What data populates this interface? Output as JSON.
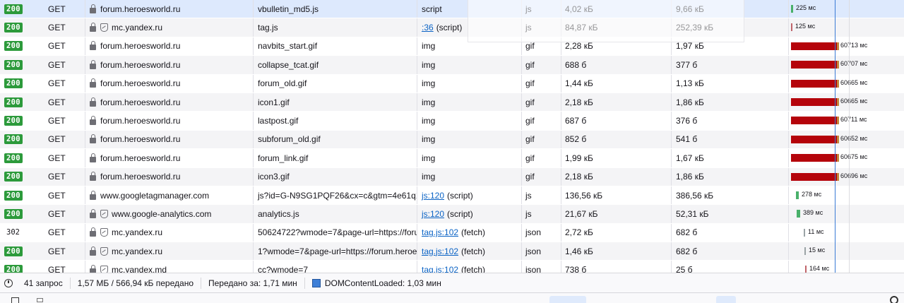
{
  "colors": {
    "status_ok": "#2c9a3b",
    "waterfall_block": "#b5040b",
    "waterfall_green": "#49b06a",
    "selected_row": "#dde9fd",
    "link": "#0b63c5"
  },
  "requests": [
    {
      "status": "200",
      "status_badge": true,
      "method": "GET",
      "tracker": false,
      "domain": "forum.heroesworld.ru",
      "file": "vbulletin_md5.js",
      "initiator_link": "",
      "initiator": "script",
      "type": "js",
      "transferred": "4,02 кБ",
      "size": "9,66 кБ",
      "timing": "225 мс",
      "blocked_ms": 0,
      "wait_ms": 225,
      "selected": true
    },
    {
      "status": "200",
      "status_badge": true,
      "method": "GET",
      "tracker": true,
      "domain": "mc.yandex.ru",
      "file": "tag.js",
      "initiator_link": ":36",
      "initiator": "(script)",
      "type": "js",
      "transferred": "84,87 кБ",
      "size": "252,39 кБ",
      "timing": "125 мс",
      "blocked_ms": 0,
      "wait_ms": 125,
      "selected": false
    },
    {
      "status": "200",
      "status_badge": true,
      "method": "GET",
      "tracker": false,
      "domain": "forum.heroesworld.ru",
      "file": "navbits_start.gif",
      "initiator_link": "",
      "initiator": "img",
      "type": "gif",
      "transferred": "2,28 кБ",
      "size": "1,97 кБ",
      "timing": "60713 мс",
      "blocked_ms": 60713,
      "wait_ms": 0,
      "selected": false
    },
    {
      "status": "200",
      "status_badge": true,
      "method": "GET",
      "tracker": false,
      "domain": "forum.heroesworld.ru",
      "file": "collapse_tcat.gif",
      "initiator_link": "",
      "initiator": "img",
      "type": "gif",
      "transferred": "688 б",
      "size": "377 б",
      "timing": "60707 мс",
      "blocked_ms": 60707,
      "wait_ms": 0,
      "selected": false
    },
    {
      "status": "200",
      "status_badge": true,
      "method": "GET",
      "tracker": false,
      "domain": "forum.heroesworld.ru",
      "file": "forum_old.gif",
      "initiator_link": "",
      "initiator": "img",
      "type": "gif",
      "transferred": "1,44 кБ",
      "size": "1,13 кБ",
      "timing": "60665 мс",
      "blocked_ms": 60665,
      "wait_ms": 0,
      "selected": false
    },
    {
      "status": "200",
      "status_badge": true,
      "method": "GET",
      "tracker": false,
      "domain": "forum.heroesworld.ru",
      "file": "icon1.gif",
      "initiator_link": "",
      "initiator": "img",
      "type": "gif",
      "transferred": "2,18 кБ",
      "size": "1,86 кБ",
      "timing": "60665 мс",
      "blocked_ms": 60665,
      "wait_ms": 0,
      "selected": false
    },
    {
      "status": "200",
      "status_badge": true,
      "method": "GET",
      "tracker": false,
      "domain": "forum.heroesworld.ru",
      "file": "lastpost.gif",
      "initiator_link": "",
      "initiator": "img",
      "type": "gif",
      "transferred": "687 б",
      "size": "376 б",
      "timing": "60711 мс",
      "blocked_ms": 60711,
      "wait_ms": 0,
      "selected": false
    },
    {
      "status": "200",
      "status_badge": true,
      "method": "GET",
      "tracker": false,
      "domain": "forum.heroesworld.ru",
      "file": "subforum_old.gif",
      "initiator_link": "",
      "initiator": "img",
      "type": "gif",
      "transferred": "852 б",
      "size": "541 б",
      "timing": "60652 мс",
      "blocked_ms": 60652,
      "wait_ms": 0,
      "selected": false
    },
    {
      "status": "200",
      "status_badge": true,
      "method": "GET",
      "tracker": false,
      "domain": "forum.heroesworld.ru",
      "file": "forum_link.gif",
      "initiator_link": "",
      "initiator": "img",
      "type": "gif",
      "transferred": "1,99 кБ",
      "size": "1,67 кБ",
      "timing": "60675 мс",
      "blocked_ms": 60675,
      "wait_ms": 0,
      "selected": false
    },
    {
      "status": "200",
      "status_badge": true,
      "method": "GET",
      "tracker": false,
      "domain": "forum.heroesworld.ru",
      "file": "icon3.gif",
      "initiator_link": "",
      "initiator": "img",
      "type": "gif",
      "transferred": "2,18 кБ",
      "size": "1,86 кБ",
      "timing": "60696 мс",
      "blocked_ms": 60696,
      "wait_ms": 0,
      "selected": false
    },
    {
      "status": "200",
      "status_badge": true,
      "method": "GET",
      "tracker": false,
      "domain": "www.googletagmanager.com",
      "file": "js?id=G-N9SG1PQF26&cx=c&gtm=4e61q1",
      "initiator_link": "js:120",
      "initiator": "(script)",
      "type": "js",
      "transferred": "136,56 кБ",
      "size": "386,56 кБ",
      "timing": "278 мс",
      "blocked_ms": 0,
      "wait_ms": 278,
      "selected": false
    },
    {
      "status": "200",
      "status_badge": true,
      "method": "GET",
      "tracker": true,
      "domain": "www.google-analytics.com",
      "file": "analytics.js",
      "initiator_link": "js:120",
      "initiator": "(script)",
      "type": "js",
      "transferred": "21,67 кБ",
      "size": "52,31 кБ",
      "timing": "389 мс",
      "blocked_ms": 0,
      "wait_ms": 389,
      "selected": false
    },
    {
      "status": "302",
      "status_badge": false,
      "method": "GET",
      "tracker": true,
      "domain": "mc.yandex.ru",
      "file": "50624722?wmode=7&page-url=https://foru",
      "initiator_link": "tag.js:102",
      "initiator": "(fetch)",
      "type": "json",
      "transferred": "2,72 кБ",
      "size": "682 б",
      "timing": "11 мс",
      "blocked_ms": 0,
      "wait_ms": 11,
      "selected": false
    },
    {
      "status": "200",
      "status_badge": true,
      "method": "GET",
      "tracker": true,
      "domain": "mc.yandex.ru",
      "file": "1?wmode=7&page-url=https://forum.heroe",
      "initiator_link": "tag.js:102",
      "initiator": "(fetch)",
      "type": "json",
      "transferred": "1,46 кБ",
      "size": "682 б",
      "timing": "15 мс",
      "blocked_ms": 0,
      "wait_ms": 15,
      "selected": false
    },
    {
      "status": "200",
      "status_badge": true,
      "method": "GET",
      "tracker": true,
      "domain": "mc.yandex.md",
      "file": "cc?wmode=7",
      "initiator_link": "tag.js:102",
      "initiator": "(fetch)",
      "type": "json",
      "transferred": "738 б",
      "size": "25 б",
      "timing": "164 мс",
      "blocked_ms": 0,
      "wait_ms": 164,
      "selected": false
    }
  ],
  "summary": {
    "requests": "41 запрос",
    "transferred": "1,57 МБ / 566,94 кБ передано",
    "finish": "Передано за: 1,71 мин",
    "dcl": "DOMContentLoaded: 1,03 мин"
  }
}
